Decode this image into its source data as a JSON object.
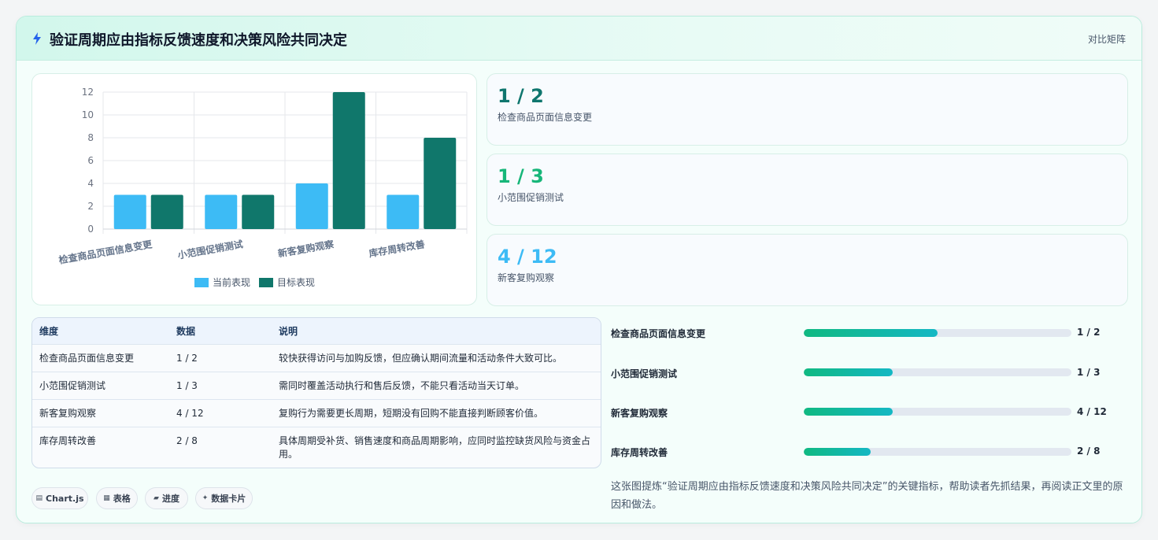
{
  "header": {
    "title": "验证周期应由指标反馈速度和决策风险共同决定",
    "tag": "对比矩阵"
  },
  "colors": {
    "current": "#3dbbf5",
    "target": "#10776b",
    "stat_1": "#0f766e",
    "stat_2": "#16b679",
    "stat_3": "#3dbbf5"
  },
  "chart_data": {
    "type": "bar",
    "categories": [
      "检查商品页面信息变更",
      "小范围促销测试",
      "新客复购观察",
      "库存周转改善"
    ],
    "series": [
      {
        "name": "当前表现",
        "values": [
          3,
          3,
          4,
          3
        ]
      },
      {
        "name": "目标表现",
        "values": [
          3,
          3,
          12,
          8
        ]
      }
    ],
    "ylim": [
      0,
      12
    ],
    "yticks": [
      0,
      2,
      4,
      6,
      8,
      10,
      12
    ],
    "grid": true,
    "legend": "bottom"
  },
  "stats": [
    {
      "value": "1 / 2",
      "label": "检查商品页面信息变更"
    },
    {
      "value": "1 / 3",
      "label": "小范围促销测试"
    },
    {
      "value": "4 / 12",
      "label": "新客复购观察"
    }
  ],
  "table": {
    "headers": [
      "维度",
      "数据",
      "说明"
    ],
    "rows": [
      [
        "检查商品页面信息变更",
        "1 / 2",
        "较快获得访问与加购反馈，但应确认期间流量和活动条件大致可比。"
      ],
      [
        "小范围促销测试",
        "1 / 3",
        "需同时覆盖活动执行和售后反馈，不能只看活动当天订单。"
      ],
      [
        "新客复购观察",
        "4 / 12",
        "复购行为需要更长周期，短期没有回购不能直接判断顾客价值。"
      ],
      [
        "库存周转改善",
        "2 / 8",
        "具体周期受补货、销售速度和商品周期影响，应同时监控缺货风险与资金占用。"
      ]
    ]
  },
  "chips": [
    {
      "icon": "chart-icon",
      "label": "Chart.js"
    },
    {
      "icon": "table-icon",
      "label": "表格"
    },
    {
      "icon": "folder-icon",
      "label": "进度"
    },
    {
      "icon": "sparkle-icon",
      "label": "数据卡片"
    }
  ],
  "progress": [
    {
      "label": "检查商品页面信息变更",
      "value": "1 / 2",
      "fraction": 0.5
    },
    {
      "label": "小范围促销测试",
      "value": "1 / 3",
      "fraction": 0.333
    },
    {
      "label": "新客复购观察",
      "value": "4 / 12",
      "fraction": 0.333
    },
    {
      "label": "库存周转改善",
      "value": "2 / 8",
      "fraction": 0.25
    }
  ],
  "summary": "这张图提炼“验证周期应由指标反馈速度和决策风险共同决定”的关键指标，帮助读者先抓结果，再阅读正文里的原因和做法。"
}
